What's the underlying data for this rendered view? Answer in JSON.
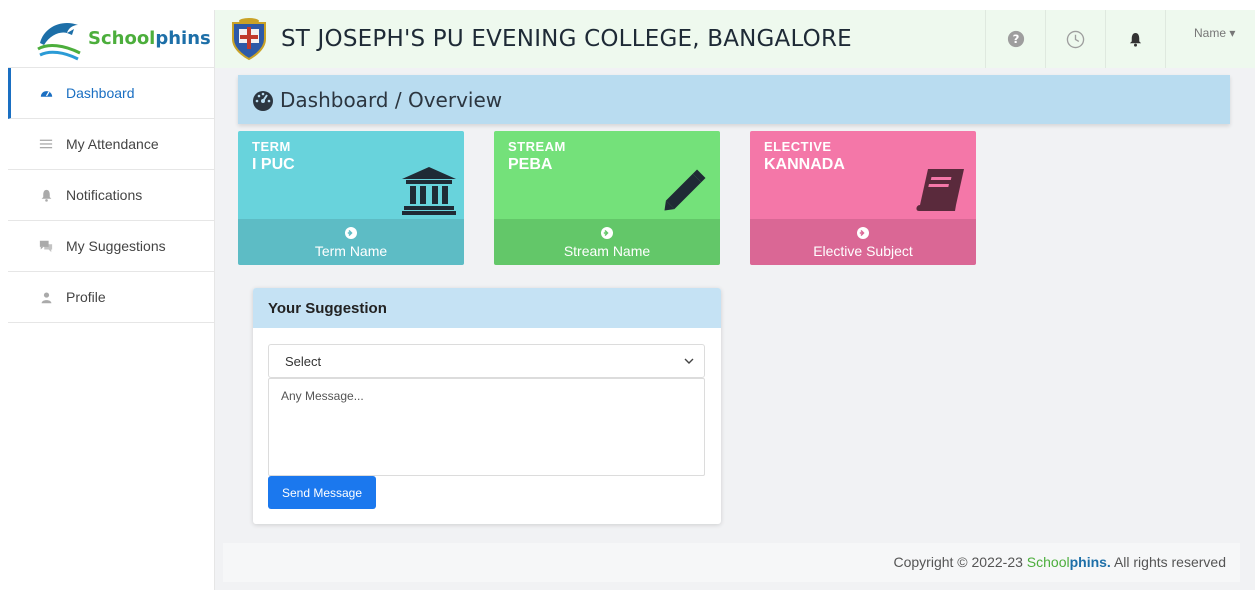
{
  "brand": {
    "part1": "School",
    "part2": "phins"
  },
  "header": {
    "college_name": "ST JOSEPH'S PU EVENING COLLEGE, BANGALORE",
    "user_name": "Name ▾"
  },
  "sidebar": {
    "items": [
      {
        "label": "Dashboard",
        "icon": "tachometer-icon"
      },
      {
        "label": "My Attendance",
        "icon": "list-icon"
      },
      {
        "label": "Notifications",
        "icon": "bell-icon"
      },
      {
        "label": "My Suggestions",
        "icon": "comments-icon"
      },
      {
        "label": "Profile",
        "icon": "user-icon"
      }
    ]
  },
  "page_title": "Dashboard / Overview",
  "cards": {
    "term": {
      "label": "TERM",
      "value": "I PUC",
      "footer": "Term Name",
      "icon": "institution-icon"
    },
    "stream": {
      "label": "STREAM",
      "value": "PEBA",
      "footer": "Stream Name",
      "icon": "pencil-icon"
    },
    "elective": {
      "label": "ELECTIVE",
      "value": "KANNADA",
      "footer": "Elective Subject",
      "icon": "book-icon"
    }
  },
  "suggestion": {
    "title": "Your Suggestion",
    "select_value": "Select",
    "message_placeholder": "Any Message...",
    "send_label": "Send Message"
  },
  "footer": {
    "prefix": "Copyright © 2022-23 ",
    "brand1": "School",
    "brand2": "phins.",
    "suffix": " All rights reserved"
  },
  "colors": {
    "accent": "#1a6fc2",
    "term": "#68d3dc",
    "stream": "#74e17a",
    "elective": "#f477a8",
    "button": "#1b78ee"
  }
}
